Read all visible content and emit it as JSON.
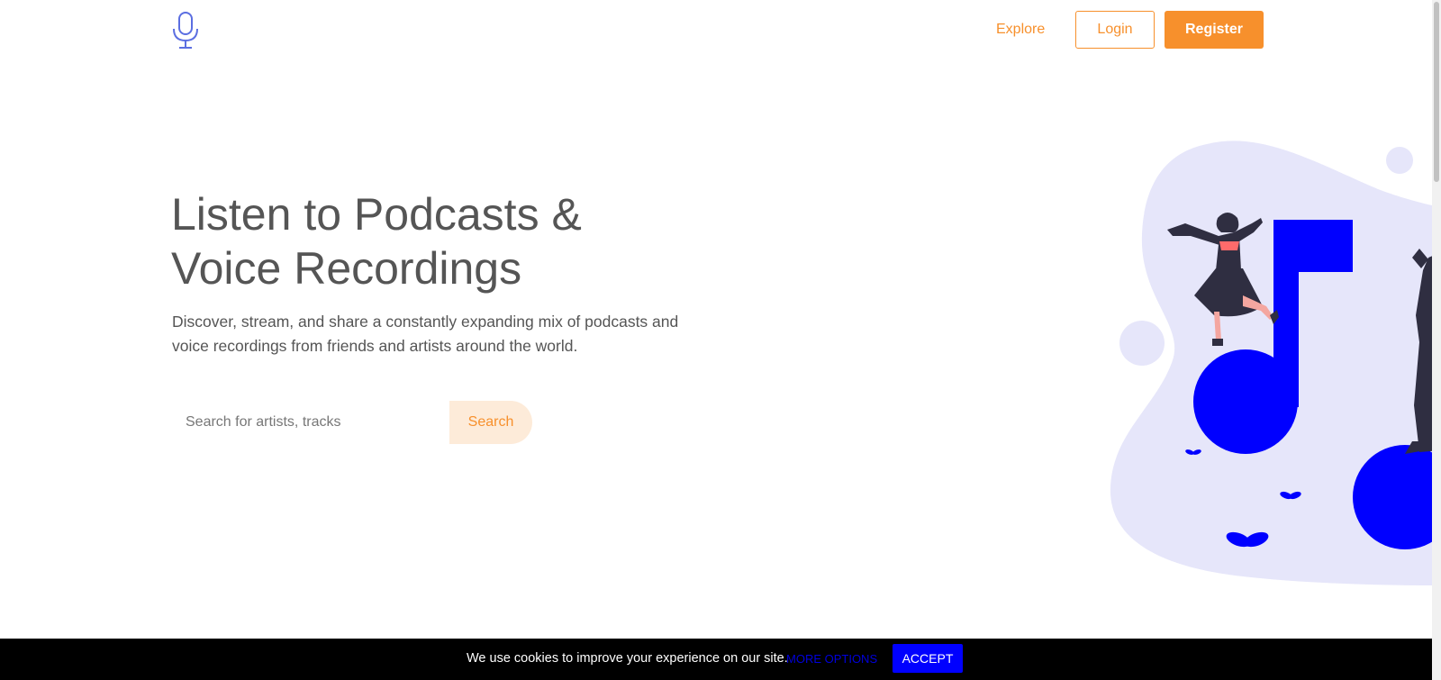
{
  "header": {
    "logo_icon": "microphone-icon",
    "explore_label": "Explore",
    "login_label": "Login",
    "register_label": "Register"
  },
  "hero": {
    "title_line1": "Listen to Podcasts &",
    "title_line2": "Voice Recordings",
    "subtitle_line1": "Discover, stream, and share a constantly expanding mix of podcasts and",
    "subtitle_line2": "voice recordings from friends and artists around the world.",
    "search": {
      "placeholder": "Search for artists, tracks",
      "value": "",
      "button_label": "Search"
    }
  },
  "cookie_bar": {
    "text": "We use cookies to improve your experience on our site.",
    "more_options_label": "MORE OPTIONS",
    "accept_label": "ACCEPT"
  },
  "colors": {
    "accent": "#f7902c",
    "accent_light": "#fdebd9",
    "logo_blue": "#5b6ee1",
    "illustration_blue": "#0000ff",
    "blob_lavender": "#e6e6fa",
    "text_gray": "#555555",
    "cookie_bg": "#000000"
  }
}
